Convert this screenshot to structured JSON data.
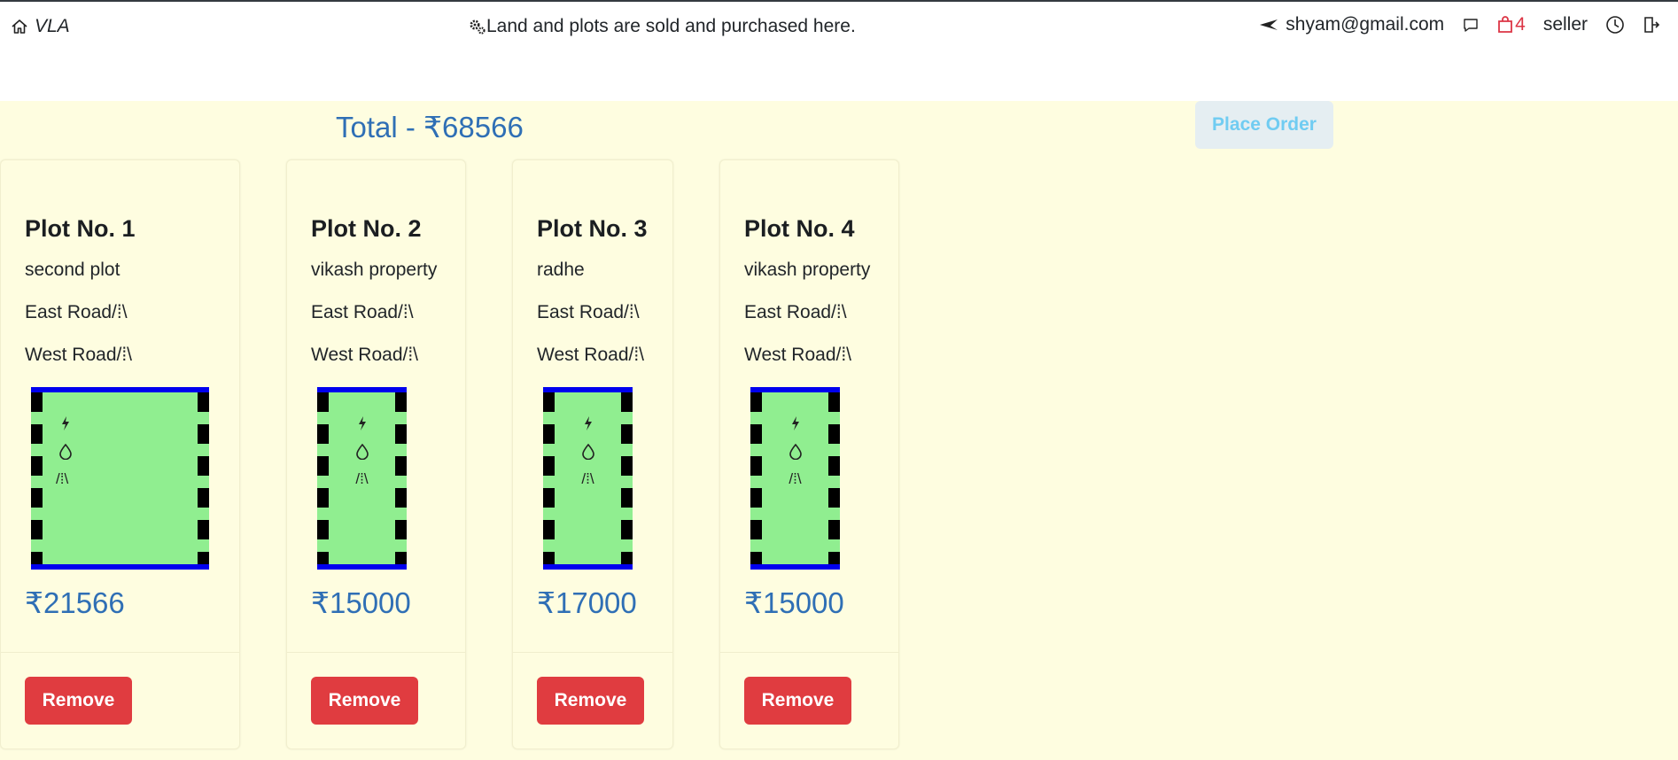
{
  "navbar": {
    "brand": "VLA",
    "tagline": "Land and plots are sold and purchased here.",
    "email": "shyam@gmail.com",
    "cart_count": "4",
    "role": "seller"
  },
  "cart": {
    "total_label": "Total - ₹68566",
    "place_order_label": "Place Order"
  },
  "plots": [
    {
      "title": "Plot No. 1",
      "name": "second plot",
      "east": "East Road/⁞\\",
      "west": "West Road/⁞\\",
      "road_glyph": "/⁞\\",
      "price": "₹21566",
      "remove_label": "Remove"
    },
    {
      "title": "Plot No. 2",
      "name": "vikash property",
      "east": "East Road/⁞\\",
      "west": "West Road/⁞\\",
      "road_glyph": "/⁞\\",
      "price": "₹15000",
      "remove_label": "Remove"
    },
    {
      "title": "Plot No. 3",
      "name": "radhe",
      "east": "East Road/⁞\\",
      "west": "West Road/⁞\\",
      "road_glyph": "/⁞\\",
      "price": "₹17000",
      "remove_label": "Remove"
    },
    {
      "title": "Plot No. 4",
      "name": "vikash property",
      "east": "East Road/⁞\\",
      "west": "West Road/⁞\\",
      "road_glyph": "/⁞\\",
      "price": "₹15000",
      "remove_label": "Remove"
    }
  ],
  "icons": {
    "home": "house-icon",
    "gears": "gears-icon",
    "plane": "paper-plane-icon",
    "chat": "chat-icon",
    "cart": "bag-icon",
    "history": "clock-icon",
    "logout": "logout-icon",
    "electricity": "lightning-icon",
    "water": "droplet-icon"
  },
  "colors": {
    "accent": "#2f6fb5",
    "danger": "#e03c40",
    "plot_fill": "#90ee90",
    "plot_border": "#0000ee",
    "background": "#fefde0"
  }
}
